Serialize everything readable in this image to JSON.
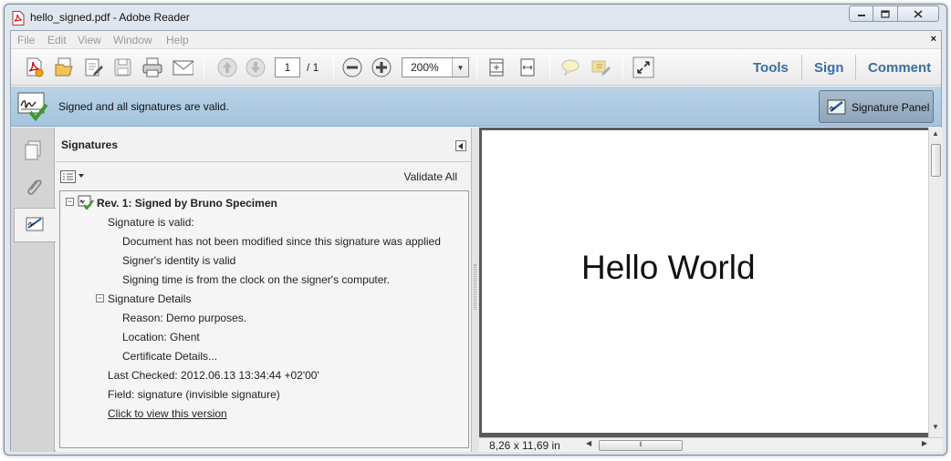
{
  "window": {
    "title": "hello_signed.pdf - Adobe Reader",
    "controls": [
      "minimize",
      "restore",
      "close"
    ]
  },
  "menubar": {
    "items": [
      "File",
      "Edit",
      "View",
      "Window",
      "Help"
    ],
    "close_glyph": "×"
  },
  "toolbar": {
    "icons": [
      "create-pdf-icon",
      "open-icon",
      "edit-icon",
      "save-icon",
      "print-icon",
      "email-icon",
      "previous-page-icon",
      "next-page-icon",
      "zoom-out-icon",
      "zoom-in-icon",
      "fit-page-icon",
      "fit-width-icon",
      "comment-icon",
      "highlight-icon",
      "read-mode-icon"
    ],
    "page_current": "1",
    "page_total": "/ 1",
    "zoom_value": "200%",
    "links": {
      "tools": "Tools",
      "sign": "Sign",
      "comment": "Comment"
    },
    "link_color": "#3a6ea5"
  },
  "signature_bar": {
    "message": "Signed and all signatures are valid.",
    "panel_button": "Signature Panel",
    "bar_color": "#b0cde3"
  },
  "signatures_panel": {
    "title": "Signatures",
    "validate_all": "Validate All",
    "tree": {
      "revision": "Rev. 1: Signed by Bruno Specimen",
      "valid_header": "Signature is valid:",
      "valid_items": [
        "Document has not been modified since this signature was applied",
        "Signer's identity is valid",
        "Signing time is from the clock on the signer's computer."
      ],
      "details_header": "Signature Details",
      "details_items": [
        "Reason: Demo purposes.",
        "Location: Ghent",
        "Certificate Details..."
      ],
      "last_checked": "Last Checked: 2012.06.13 13:34:44 +02'00'",
      "field": "Field: signature (invisible signature)",
      "view_version": "Click to view this version"
    }
  },
  "document": {
    "content": "Hello World",
    "page_size": "8,26 x 11,69 in"
  }
}
